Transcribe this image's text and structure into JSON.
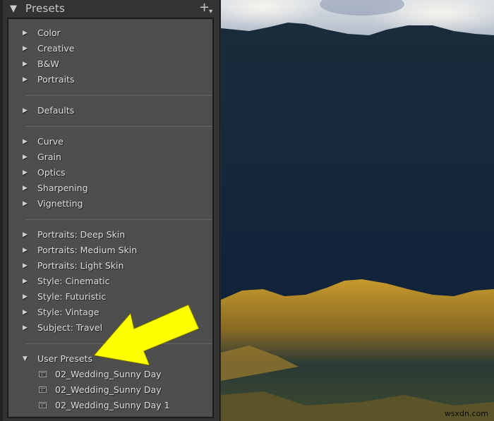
{
  "panel": {
    "title": "Presets",
    "collapse_icon": "triangle-down-icon",
    "add_icon": "plus-icon",
    "groups": [
      {
        "items": [
          {
            "label": "Color"
          },
          {
            "label": "Creative"
          },
          {
            "label": "B&W"
          },
          {
            "label": "Portraits"
          }
        ]
      },
      {
        "items": [
          {
            "label": "Defaults"
          }
        ]
      },
      {
        "items": [
          {
            "label": "Curve"
          },
          {
            "label": "Grain"
          },
          {
            "label": "Optics"
          },
          {
            "label": "Sharpening"
          },
          {
            "label": "Vignetting"
          }
        ]
      },
      {
        "items": [
          {
            "label": "Portraits: Deep Skin"
          },
          {
            "label": "Portraits: Medium Skin"
          },
          {
            "label": "Portraits: Light Skin"
          },
          {
            "label": "Style: Cinematic"
          },
          {
            "label": "Style: Futuristic"
          },
          {
            "label": "Style: Vintage"
          },
          {
            "label": "Subject: Travel"
          }
        ]
      }
    ],
    "user_presets": {
      "label": "User Presets",
      "expanded": true,
      "items": [
        {
          "label": "02_Wedding_Sunny Day"
        },
        {
          "label": "02_Wedding_Sunny Day"
        },
        {
          "label": "02_Wedding_Sunny Day 1"
        }
      ]
    },
    "collapsed_glyph": "▶",
    "expanded_glyph": "▼"
  },
  "annotation": {
    "type": "arrow",
    "color": "#ffff00",
    "points_to": "User Presets"
  },
  "photo": {
    "description": "Landscape photo: cloudy sky over dark forested ridge with sunlit golden grass in foreground"
  },
  "watermark": "wsxdn.com"
}
